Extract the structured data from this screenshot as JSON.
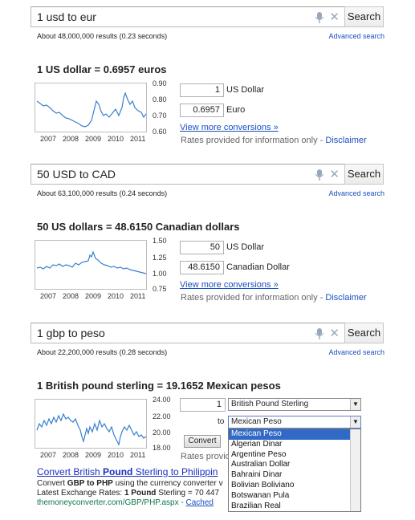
{
  "sections": [
    {
      "query": "1 usd to eur",
      "stats": "About 48,000,000 results (0.23 seconds)",
      "advanced": "Advanced search",
      "search_label": "Search",
      "headline": "1 US dollar = 0.6957 euros",
      "amount_from": "1",
      "unit_from": "US Dollar",
      "amount_to": "0.6957",
      "unit_to": "Euro",
      "more_link": "View more conversions »",
      "note": "Rates provided for information only - ",
      "disclaimer": "Disclaimer",
      "chart_yticks": [
        "0.90",
        "0.80",
        "0.70",
        "0.60"
      ],
      "chart_xticks": [
        "2007",
        "2008",
        "2009",
        "2010",
        "2011"
      ]
    },
    {
      "query": "50 USD to CAD",
      "stats": "About 63,100,000 results (0.24 seconds)",
      "advanced": "Advanced search",
      "search_label": "Search",
      "headline": "50 US dollars = 48.6150 Canadian dollars",
      "amount_from": "50",
      "unit_from": "US Dollar",
      "amount_to": "48.6150",
      "unit_to": "Canadian Dollar",
      "more_link": "View more conversions »",
      "note": "Rates provided for information only - ",
      "disclaimer": "Disclaimer",
      "chart_yticks": [
        "1.50",
        "1.25",
        "1.00",
        "0.75"
      ],
      "chart_xticks": [
        "2007",
        "2008",
        "2009",
        "2010",
        "2011"
      ]
    },
    {
      "query": "1 gbp to peso",
      "stats": "About 22,200,000 results (0.28 seconds)",
      "advanced": "Advanced search",
      "search_label": "Search",
      "headline": "1 British pound sterling = 19.1652 Mexican pesos",
      "amount_from": "1",
      "from_select": "British Pound Sterling",
      "to_label": "to",
      "to_select": "Mexican Peso",
      "convert_label": "Convert",
      "rates_partial": "Rates provid",
      "chart_yticks": [
        "24.00",
        "22.00",
        "20.00",
        "18.00"
      ],
      "chart_xticks": [
        "2007",
        "2008",
        "2009",
        "2010",
        "2011"
      ],
      "dropdown_options": [
        "Mexican Peso",
        "Algerian Dinar",
        "Argentine Peso",
        "Australian Dollar",
        "Bahraini Dinar",
        "Bolivian Boliviano",
        "Botswanan Pula",
        "Brazilian Real"
      ],
      "result_title_pre": "Convert British ",
      "result_title_bold": "Pound",
      "result_title_post": " Sterling to Philippin",
      "result_line1_pre": "Convert ",
      "result_line1_bold": "GBP to PHP",
      "result_line1_post": " using the currency converter v",
      "result_line2_pre": "Latest Exchange Rates: ",
      "result_line2_bold": "1 Pound",
      "result_line2_post": " Sterling = 70 447",
      "result_url": "themoneyconverter.com/GBP/PHP.aspx",
      "cached": "Cached"
    }
  ],
  "colors": {
    "link": "#1a4fbf",
    "chart_line": "#3a7fd0",
    "selected": "#3169c6",
    "url": "#0e774a"
  }
}
